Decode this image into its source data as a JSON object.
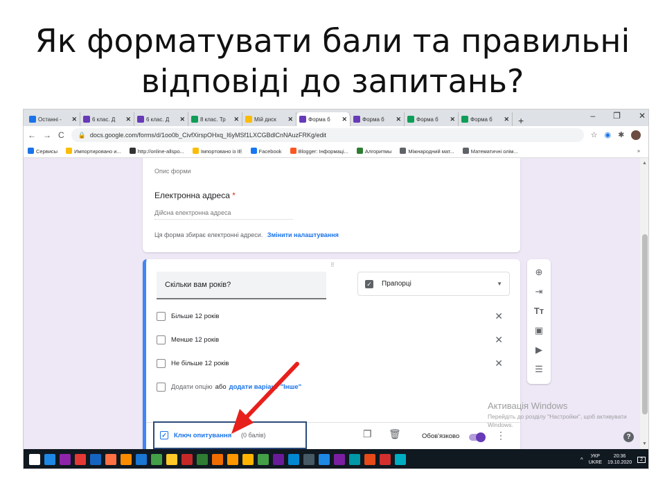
{
  "slide": {
    "title": "Як форматувати бали та правильні відповіді до запитань?"
  },
  "browser": {
    "tabs": [
      {
        "label": "Останні -",
        "color": "#1a73e8",
        "active": false
      },
      {
        "label": "6 клас. Д",
        "color": "#673ab7",
        "active": false
      },
      {
        "label": "6 клас. Д",
        "color": "#673ab7",
        "active": false
      },
      {
        "label": "8 клас. Тр",
        "color": "#0f9d58",
        "active": false
      },
      {
        "label": "Мій диск",
        "color": "#fbbc04",
        "active": false
      },
      {
        "label": "Форма б",
        "color": "#673ab7",
        "active": true
      },
      {
        "label": "Форма б",
        "color": "#673ab7",
        "active": false
      },
      {
        "label": "Форма б",
        "color": "#0f9d58",
        "active": false
      },
      {
        "label": "Форма б",
        "color": "#0f9d58",
        "active": false
      }
    ],
    "tab_close": "✕",
    "new_tab": "+",
    "win_min": "–",
    "win_max": "❐",
    "win_close": "✕",
    "nav_back": "←",
    "nav_fwd": "→",
    "nav_reload": "C",
    "url": "docs.google.com/forms/d/1oo0b_CivfXirspOHxq_I6yMSf1LXCGBdlCnNAuzFRKg/edit",
    "bookmarks": [
      {
        "label": "Сервисы",
        "color": "#1a73e8"
      },
      {
        "label": "Импортировано и...",
        "color": "#fbbc04"
      },
      {
        "label": "http://online-allspo...",
        "color": "#333333"
      },
      {
        "label": "Імпортовано із IE",
        "color": "#fbbc04"
      },
      {
        "label": "Facebook",
        "color": "#1877f2"
      },
      {
        "label": "Blogger: Інформаці...",
        "color": "#ff5722"
      },
      {
        "label": "Алгоритмы",
        "color": "#2e7d32"
      },
      {
        "label": "Міжнародний мат...",
        "color": "#5f6368"
      },
      {
        "label": "Математичні олім...",
        "color": "#5f6368"
      }
    ],
    "bookmarks_more": "»"
  },
  "form": {
    "description_label": "Опис форми",
    "email_label": "Електронна адреса",
    "required_star": "*",
    "email_placeholder": "Дійсна електронна адреса",
    "email_note": "Ця форма збирає електронні адреси.",
    "change_settings": "Змінити налаштування",
    "question": {
      "drag_handle": "⠿",
      "title": "Скільки вам років?",
      "type_label": "Прапорці",
      "options": [
        "Більше 12 років",
        "Менше 12 років",
        "Не більше 12 років"
      ],
      "add_option": "Додати опцію",
      "or": "або",
      "add_other": "додати варіант \"Інше\"",
      "answer_key": "Ключ опитування",
      "points": "(0 балів)",
      "required_label": "Обов'язково",
      "required_on": true
    },
    "sidebar_icons": [
      "add-question-icon",
      "import-questions-icon",
      "add-title-icon",
      "add-image-icon",
      "add-video-icon",
      "add-section-icon"
    ]
  },
  "watermark": {
    "title": "Активація Windows",
    "text": "Перейдіть до розділу \"Настройки\", щоб активувати Windows."
  },
  "taskbar": {
    "lang": "УКР",
    "lang2": "UKRE",
    "time": "20:36",
    "date": "19.10.2020",
    "notifications": "2"
  }
}
